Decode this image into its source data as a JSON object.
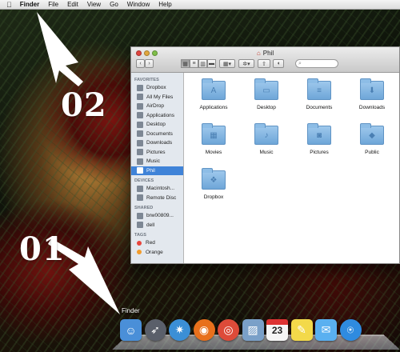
{
  "menubar": {
    "apple": "",
    "items": [
      "Finder",
      "File",
      "Edit",
      "View",
      "Go",
      "Window",
      "Help"
    ]
  },
  "window": {
    "title": "Phil",
    "search_placeholder": "",
    "sidebar": {
      "sections": [
        {
          "heading": "FAVORITES",
          "items": [
            {
              "label": "Dropbox",
              "icon": "dropbox-icon"
            },
            {
              "label": "All My Files",
              "icon": "all-files-icon"
            },
            {
              "label": "AirDrop",
              "icon": "airdrop-icon"
            },
            {
              "label": "Applications",
              "icon": "applications-icon"
            },
            {
              "label": "Desktop",
              "icon": "desktop-icon"
            },
            {
              "label": "Documents",
              "icon": "documents-icon"
            },
            {
              "label": "Downloads",
              "icon": "downloads-icon"
            },
            {
              "label": "Pictures",
              "icon": "pictures-icon"
            },
            {
              "label": "Music",
              "icon": "music-icon"
            },
            {
              "label": "Phil",
              "icon": "home-icon",
              "selected": true
            }
          ]
        },
        {
          "heading": "DEVICES",
          "items": [
            {
              "label": "Macintosh...",
              "icon": "hard-disk-icon"
            },
            {
              "label": "Remote Disc",
              "icon": "remote-disc-icon"
            }
          ]
        },
        {
          "heading": "SHARED",
          "items": [
            {
              "label": "brw00809...",
              "icon": "network-computer-icon"
            },
            {
              "label": "dell",
              "icon": "network-computer-icon"
            }
          ]
        },
        {
          "heading": "TAGS",
          "items": [
            {
              "label": "Red",
              "color": "#e8453c"
            },
            {
              "label": "Orange",
              "color": "#f39c2b"
            }
          ]
        }
      ]
    },
    "folders": [
      {
        "label": "Applications",
        "glyph": "A"
      },
      {
        "label": "Desktop",
        "glyph": "▭"
      },
      {
        "label": "Documents",
        "glyph": "≡"
      },
      {
        "label": "Downloads",
        "glyph": "⬇"
      },
      {
        "label": "Movies",
        "glyph": "▦"
      },
      {
        "label": "Music",
        "glyph": "♪"
      },
      {
        "label": "Pictures",
        "glyph": "◙"
      },
      {
        "label": "Public",
        "glyph": "◆"
      },
      {
        "label": "Dropbox",
        "glyph": "❖"
      }
    ]
  },
  "annotations": {
    "label_02": "02",
    "label_01": "01"
  },
  "dock": {
    "hover_label": "Finder",
    "calendar_day": "23",
    "apps": [
      {
        "name": "finder",
        "color": "#4a8fd8"
      },
      {
        "name": "launchpad",
        "color": "#5a5f6a"
      },
      {
        "name": "safari",
        "color": "#3b8fd6"
      },
      {
        "name": "firefox",
        "color": "#e8701c"
      },
      {
        "name": "chrome",
        "color": "#dd4b39"
      },
      {
        "name": "preview",
        "color": "#7aa0c8"
      },
      {
        "name": "calendar",
        "color": "#f5f5f5"
      },
      {
        "name": "stickies",
        "color": "#f3d94a"
      },
      {
        "name": "messages",
        "color": "#5ab0f0"
      },
      {
        "name": "app-store",
        "color": "#2f8be0"
      }
    ]
  }
}
